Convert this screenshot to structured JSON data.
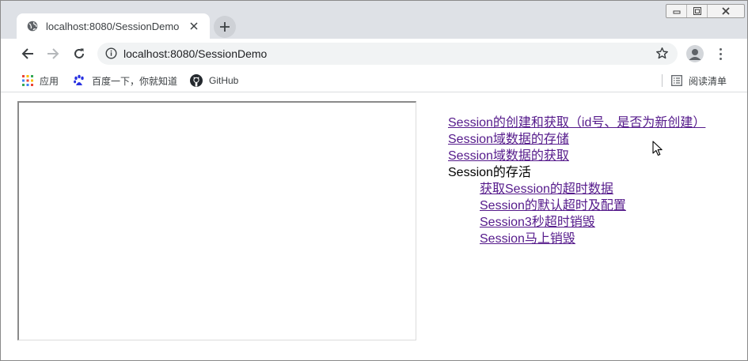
{
  "browser": {
    "tab": {
      "title": "localhost:8080/SessionDemo",
      "icon": "globe-icon"
    },
    "address_bar": {
      "url": "localhost:8080/SessionDemo"
    },
    "bookmarks": [
      {
        "label": "应用",
        "icon": "apps-grid-icon"
      },
      {
        "label": "百度一下，你就知道",
        "icon": "baidu-paw-icon"
      },
      {
        "label": "GitHub",
        "icon": "github-icon"
      }
    ],
    "reading_list": {
      "label": "阅读清单",
      "icon": "reading-list-icon"
    }
  },
  "page": {
    "links": [
      "Session的创建和获取（id号、是否为新创建）",
      "Session域数据的存储",
      "Session域数据的获取"
    ],
    "section_title": "Session的存活",
    "sub_links": [
      "获取Session的超时数据",
      "Session的默认超时及配置",
      "Session3秒超时销毁",
      "Session马上销毁"
    ]
  },
  "colors": {
    "visited_link": "#551a8b",
    "tab_strip": "#dee1e6",
    "omnibox": "#f1f3f4"
  }
}
